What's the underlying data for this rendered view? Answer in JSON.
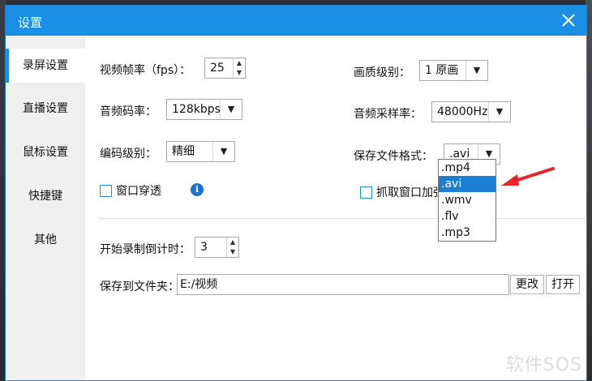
{
  "window": {
    "title": "设置"
  },
  "sidebar": {
    "items": [
      {
        "label": "录屏设置",
        "active": true
      },
      {
        "label": "直播设置"
      },
      {
        "label": "鼠标设置"
      },
      {
        "label": "快捷键"
      },
      {
        "label": "其他"
      }
    ]
  },
  "settings": {
    "fps_label": "视频帧率（fps）：",
    "fps_value": "25",
    "audio_bitrate_label": "音频码率：",
    "audio_bitrate_value": "128kbps",
    "encode_level_label": "编码级别：",
    "encode_level_value": "精细",
    "quality_label": "画质级别：",
    "quality_value": "1 原画",
    "sample_rate_label": "音频采样率：",
    "sample_rate_value": "48000Hz",
    "format_label": "保存文件格式：",
    "format_value": ".avi",
    "format_options": [
      ".mp4",
      ".avi",
      ".wmv",
      ".flv",
      ".mp3"
    ],
    "window_through_label": "窗口穿透",
    "capture_window_label": "抓取窗口加强",
    "countdown_label": "开始录制倒计时：",
    "countdown_value": "3",
    "save_folder_label": "保存到文件夹：",
    "save_folder_value": "E:/视频",
    "change_button": "更改",
    "open_button": "打开"
  },
  "watermark": "软件SOS",
  "colors": {
    "accent": "#1b8ee6",
    "annotation_arrow": "#e8252a"
  }
}
